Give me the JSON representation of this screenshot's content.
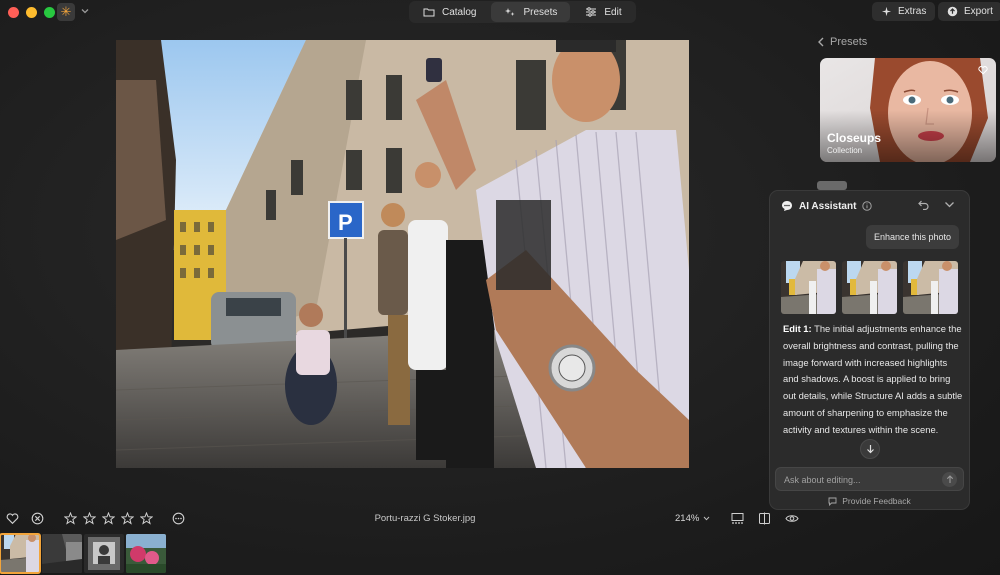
{
  "titlebar": {
    "tabs": [
      {
        "label": "Catalog",
        "icon": "folder-icon",
        "active": false
      },
      {
        "label": "Presets",
        "icon": "sparkle-icon",
        "active": true
      },
      {
        "label": "Edit",
        "icon": "sliders-icon",
        "active": false
      }
    ],
    "extras_label": "Extras",
    "export_label": "Export"
  },
  "presets": {
    "back_label": "Presets",
    "card_title": "Closeups",
    "card_subtitle": "Collection"
  },
  "ai_assistant": {
    "title": "AI Assistant",
    "user_message": "Enhance this photo",
    "response_label": "Edit 1:",
    "response_text": " The initial adjustments enhance the overall brightness and contrast, pulling the image forward with increased highlights and shadows. A boost is applied to bring out details, while Structure AI adds a subtle amount of sharpening to emphasize the activity and textures within the scene.",
    "input_placeholder": "Ask about editing...",
    "feedback_label": "Provide Feedback"
  },
  "bottom_bar": {
    "filename": "Portu-razzi G Stoker.jpg",
    "zoom": "214%",
    "rating": 0
  },
  "colors": {
    "accent": "#f2a43a",
    "background": "#1f1f1f",
    "panel": "#2b2b2b"
  }
}
